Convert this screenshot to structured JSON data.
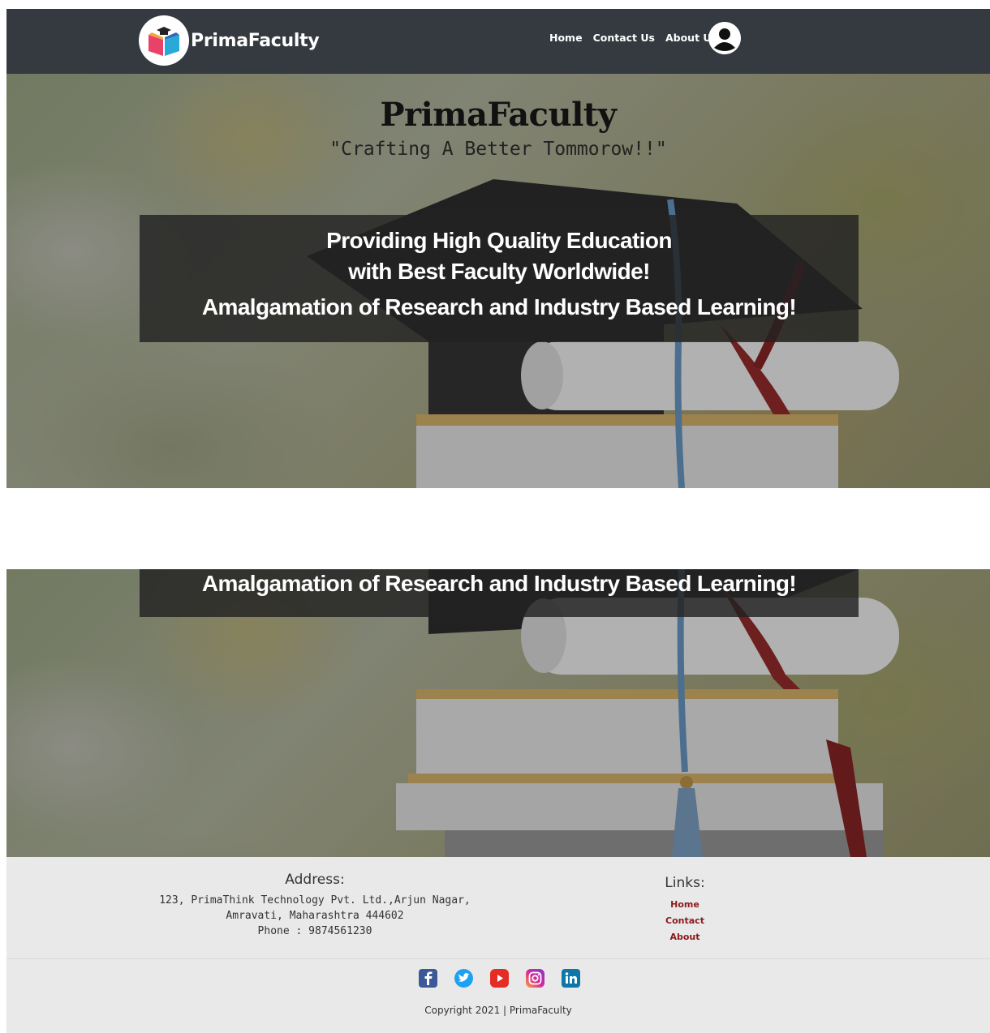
{
  "navbar": {
    "brand_name": "PrimaFaculty",
    "links": [
      "Home",
      "Contact Us",
      "About Us"
    ]
  },
  "hero": {
    "title": "PrimaFaculty",
    "tagline": "\"Crafting A Better Tommorow!!\"",
    "banner_line1": "Providing High Quality Education",
    "banner_line2": "with Best Faculty Worldwide!",
    "banner_line3": "Amalgamation of Research and Industry Based Learning!"
  },
  "footer": {
    "address_title": "Address:",
    "address_line1": "123, PrimaThink Technology Pvt. Ltd.,Arjun Nagar,",
    "address_line2": "Amravati, Maharashtra 444602",
    "address_line3": "Phone : 9874561230",
    "links_title": "Links:",
    "links": [
      "Home",
      "Contact",
      "About"
    ],
    "social_icons": [
      "facebook-icon",
      "twitter-icon",
      "youtube-icon",
      "instagram-icon",
      "linkedin-icon"
    ],
    "copyright": "Copyright 2021 | PrimaFaculty"
  },
  "colors": {
    "navbar": "#343a40",
    "footer": "#e9e9e9",
    "footer_link": "#8b1a1a",
    "banner": "#222222"
  }
}
